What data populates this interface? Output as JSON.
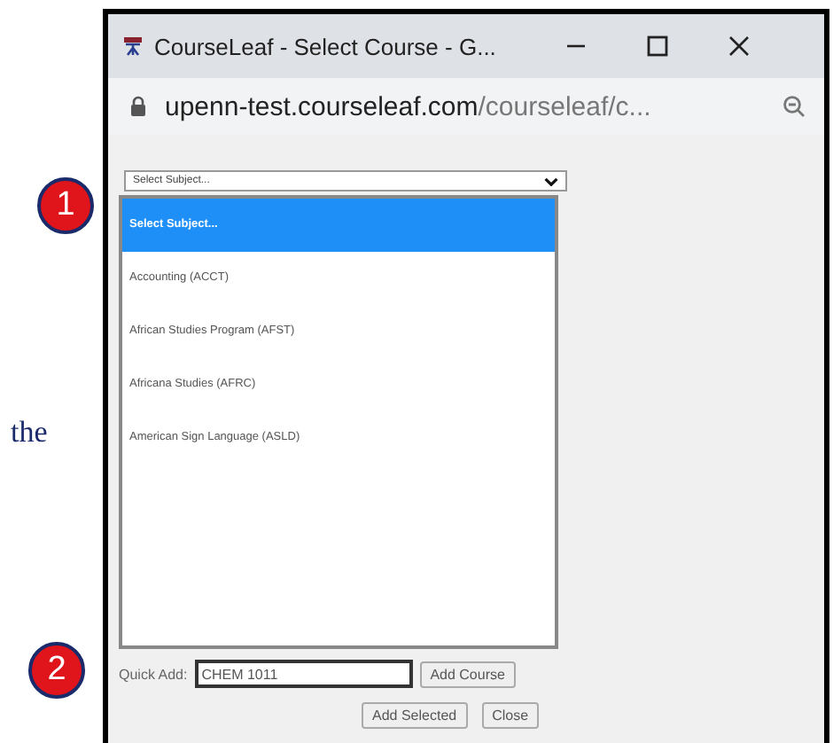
{
  "background_text": "the",
  "callouts": [
    "1",
    "2"
  ],
  "window": {
    "title": "CourseLeaf - Select Course - G..."
  },
  "address_bar": {
    "domain": "upenn-test.courseleaf.com",
    "path": "/courseleaf/c..."
  },
  "subject_select": {
    "value": "Select Subject..."
  },
  "subject_list": [
    {
      "label": "Select Subject...",
      "selected": true
    },
    {
      "label": "Accounting (ACCT)",
      "selected": false
    },
    {
      "label": "African Studies Program (AFST)",
      "selected": false
    },
    {
      "label": "Africana Studies (AFRC)",
      "selected": false
    },
    {
      "label": "American Sign Language (ASLD)",
      "selected": false
    }
  ],
  "quick_add": {
    "label": "Quick Add:",
    "value": "CHEM 1011",
    "button": "Add Course"
  },
  "buttons": [
    "Add Selected",
    "Close"
  ]
}
